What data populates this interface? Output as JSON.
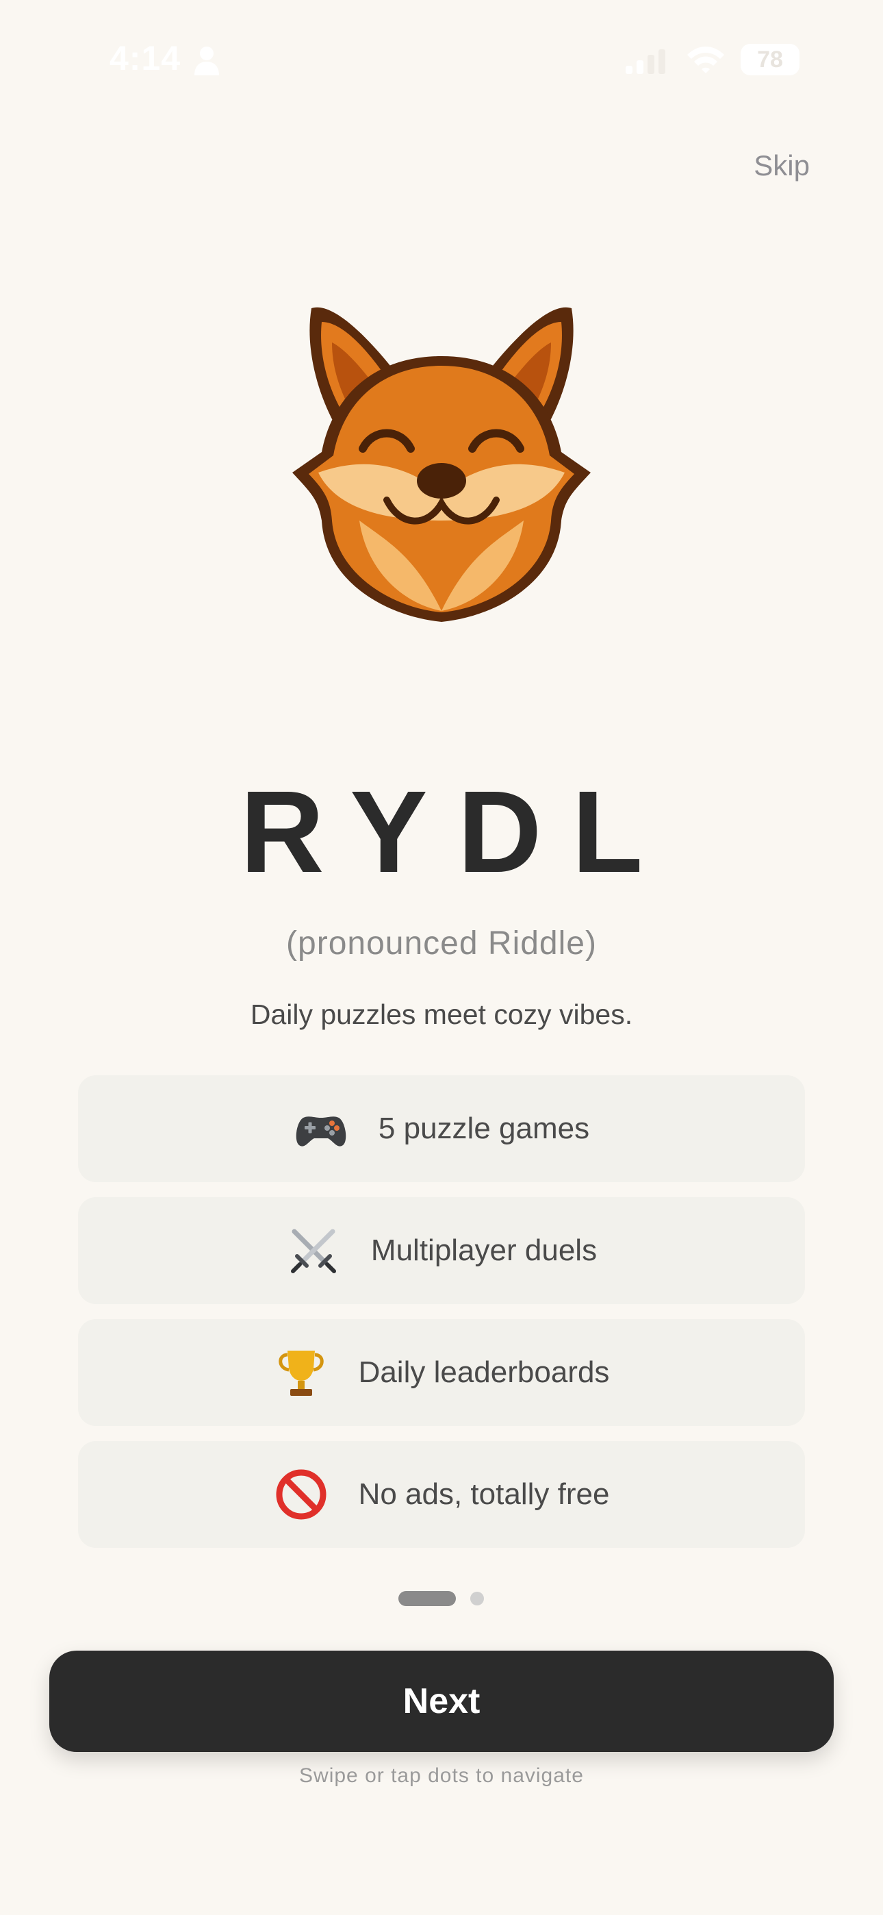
{
  "status_bar": {
    "time": "4:14",
    "battery": "78",
    "icons": [
      "person-icon",
      "signal-icon",
      "wifi-icon",
      "battery-icon"
    ]
  },
  "skip_label": "Skip",
  "mascot": {
    "icon": "fox-mascot-icon"
  },
  "app": {
    "title": "RYDL",
    "pronunciation": "(pronounced Riddle)",
    "tagline": "Daily puzzles meet cozy vibes."
  },
  "features": [
    {
      "icon": "game-controller-icon",
      "label": "5 puzzle games"
    },
    {
      "icon": "crossed-swords-icon",
      "label": "Multiplayer duels"
    },
    {
      "icon": "trophy-icon",
      "label": "Daily leaderboards"
    },
    {
      "icon": "no-entry-icon",
      "label": "No ads, totally free"
    }
  ],
  "pagination": {
    "current": 1,
    "total": 2
  },
  "next_label": "Next",
  "hint": "Swipe or tap dots to navigate",
  "colors": {
    "background": "#faf7f2",
    "card": "#f2f1ec",
    "button": "#2b2b2b",
    "accent_fox": "#e0701a"
  }
}
